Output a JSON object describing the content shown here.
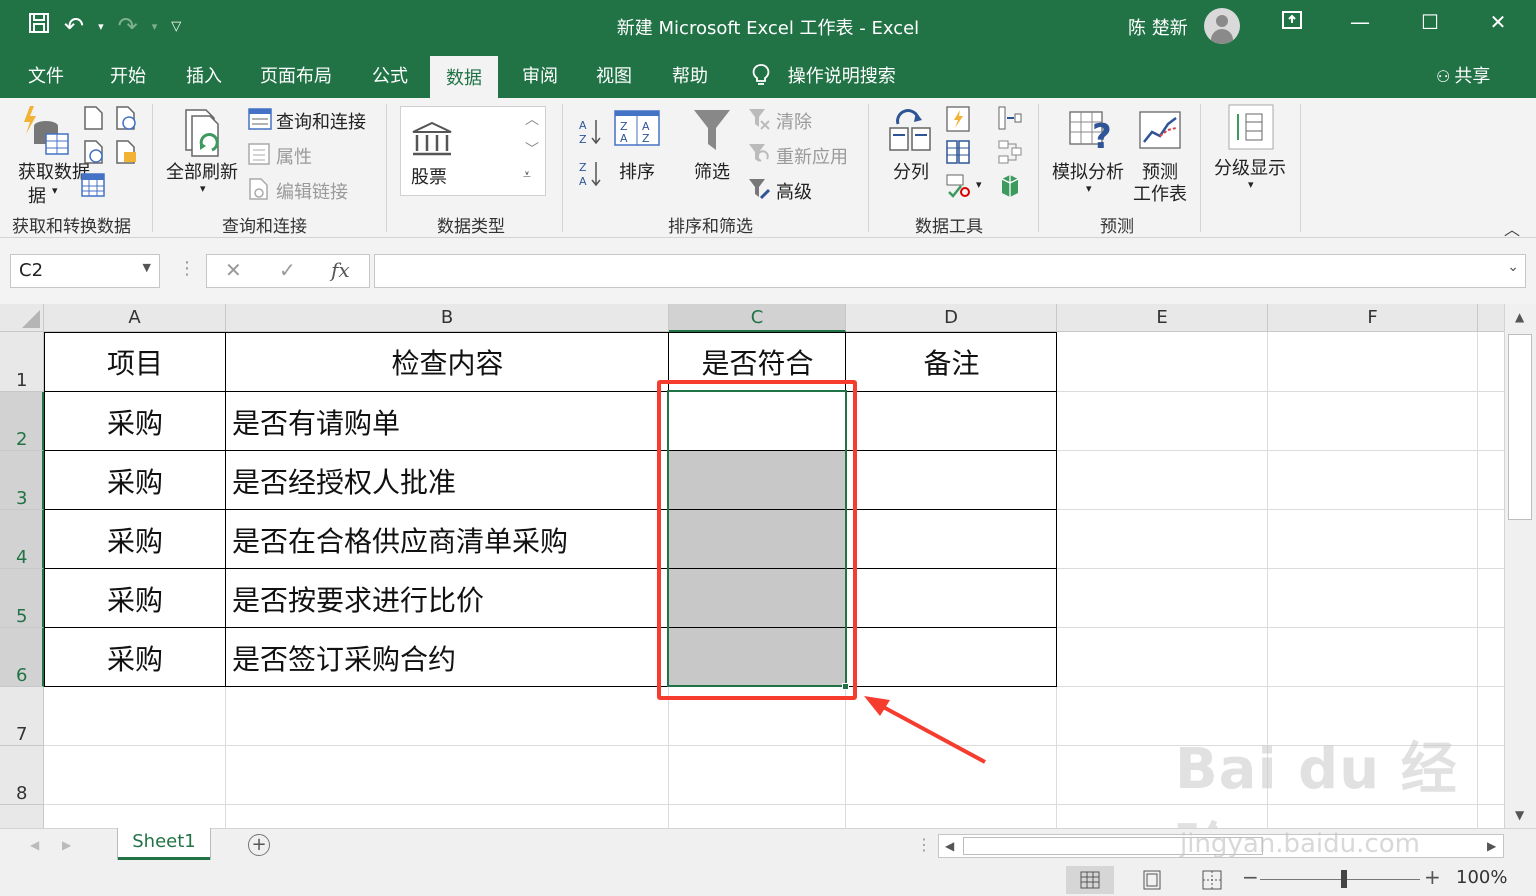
{
  "window": {
    "title": "新建 Microsoft Excel 工作表  -  Excel",
    "user": "陈 楚新"
  },
  "tabs": [
    "文件",
    "开始",
    "插入",
    "页面布局",
    "公式",
    "数据",
    "审阅",
    "视图",
    "帮助"
  ],
  "active_tab": "数据",
  "tell_me": "操作说明搜索",
  "share": "共享",
  "ribbon": {
    "get_data": "获取数据",
    "get_data_2": "据",
    "group_get_transform": "获取和转换数据",
    "refresh_all": "全部刷新",
    "queries_connections": "查询和连接",
    "properties": "属性",
    "edit_links": "编辑链接",
    "group_queries": "查询和连接",
    "stocks": "股票",
    "group_data_types": "数据类型",
    "sort": "排序",
    "filter": "筛选",
    "clear": "清除",
    "reapply": "重新应用",
    "advanced": "高级",
    "group_sort_filter": "排序和筛选",
    "text_to_columns": "分列",
    "group_data_tools": "数据工具",
    "what_if": "模拟分析",
    "forecast_1": "预测",
    "forecast_2": "工作表",
    "group_forecast": "预测",
    "outline": "分级显示"
  },
  "formula_bar": {
    "name_box": "C2",
    "fx": "fx",
    "formula": ""
  },
  "columns": [
    "A",
    "B",
    "C",
    "D",
    "E",
    "F"
  ],
  "rows": [
    "1",
    "2",
    "3",
    "4",
    "5",
    "6",
    "7",
    "8"
  ],
  "table": {
    "headers": [
      "项目",
      "检查内容",
      "是否符合",
      "备注"
    ],
    "rows": [
      [
        "采购",
        "是否有请购单"
      ],
      [
        "采购",
        "是否经授权人批准"
      ],
      [
        "采购",
        "是否在合格供应商清单采购"
      ],
      [
        "采购",
        "是否按要求进行比价"
      ],
      [
        "采购",
        "是否签订采购合约"
      ]
    ]
  },
  "selected_cell": "C2",
  "sheet_tab": "Sheet1",
  "zoom": "100%",
  "watermark": "Bai du 经验",
  "watermark_url": "jingyan.baidu.com",
  "colors": {
    "excel_green": "#217346",
    "annotation_red": "#f53c2e",
    "selection_fill": "#c8c8c8"
  }
}
